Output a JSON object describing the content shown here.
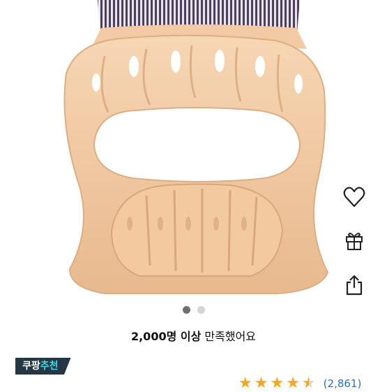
{
  "satisfaction": {
    "count": "2,000명 이상",
    "text": "만족했어요"
  },
  "badge": {
    "part1": "쿠팡",
    "part2": "추천"
  },
  "rating": {
    "stars": 4.5,
    "count": "(2,861)"
  },
  "carousel": {
    "total": 2,
    "active": 1
  },
  "colors": {
    "accent": "#243744",
    "star": "#f5a623",
    "link": "#2a6fd6"
  },
  "icons": [
    "heart-icon",
    "gift-icon",
    "share-icon"
  ]
}
